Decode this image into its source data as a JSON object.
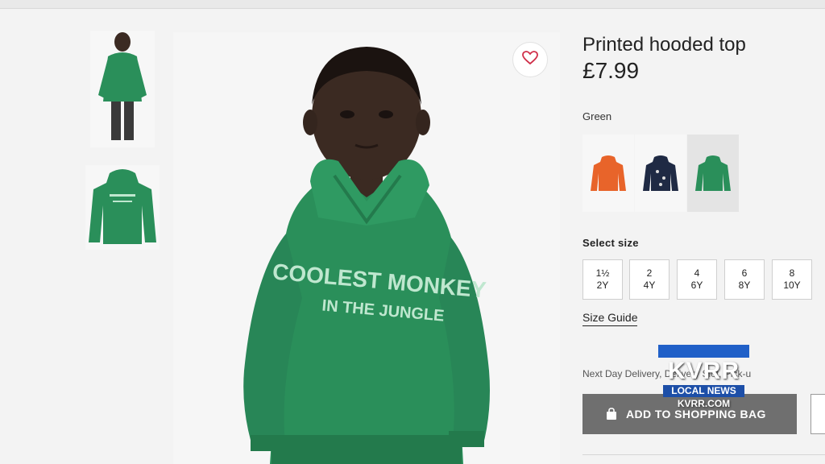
{
  "product": {
    "title": "Printed hooded top",
    "price": "£7.99",
    "print_line1": "COOLEST MONKEY",
    "print_line2": "IN THE JUNGLE"
  },
  "color": {
    "label": "Green",
    "swatches": [
      {
        "name": "Orange",
        "hex": "#e8642a",
        "selected": false
      },
      {
        "name": "Navy",
        "hex": "#1f2a44",
        "selected": false
      },
      {
        "name": "Green",
        "hex": "#2e8b57",
        "selected": true
      }
    ]
  },
  "sizes": {
    "label": "Select size",
    "options": [
      {
        "line1": "1½",
        "line2": "2Y"
      },
      {
        "line1": "2",
        "line2": "4Y"
      },
      {
        "line1": "4",
        "line2": "6Y"
      },
      {
        "line1": "6",
        "line2": "8Y"
      },
      {
        "line1": "8",
        "line2": "10Y"
      }
    ],
    "guide": "Size Guide"
  },
  "delivery_text": "Next Day Delivery, Delivery Slot, Pick-u",
  "add_to_bag": "ADD TO SHOPPING BAG",
  "watermark": {
    "call_sign": "KVRR",
    "tagline": "LOCAL NEWS",
    "site": "KVRR.COM"
  },
  "icons": [
    "heart-icon",
    "bag-icon"
  ],
  "colors": {
    "sweater_green": "#2a8f5a",
    "button_gray": "#6f6f6f",
    "logo_blue": "#2060c8"
  }
}
